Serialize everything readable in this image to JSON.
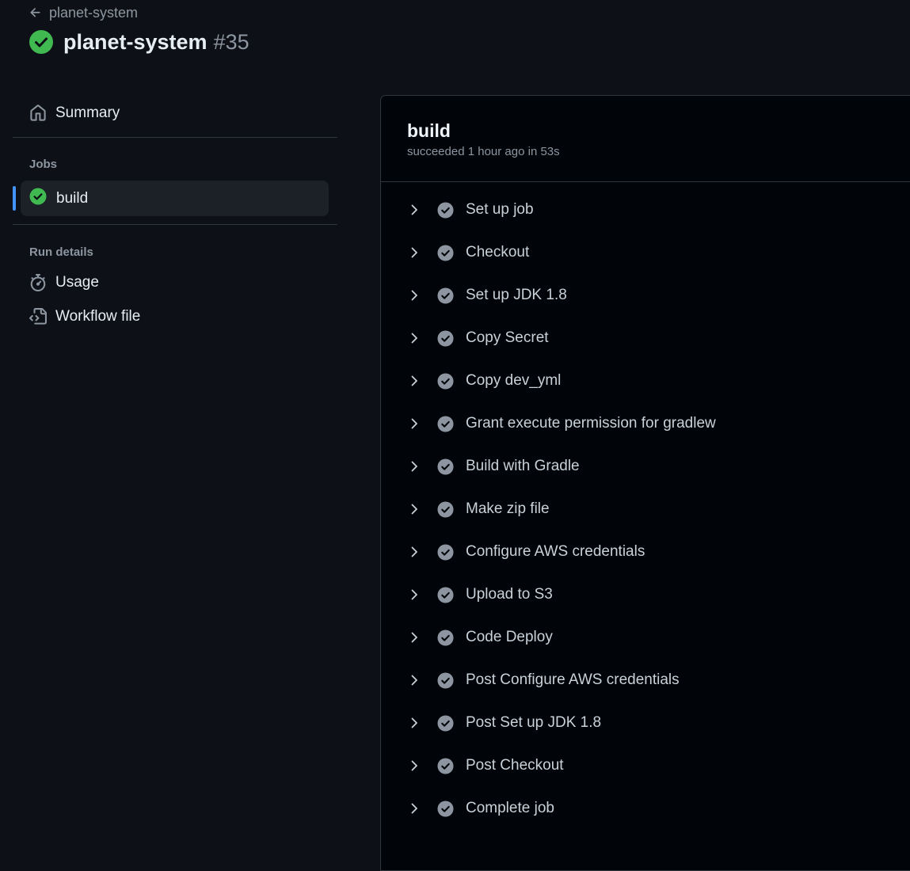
{
  "header": {
    "back_label": "planet-system",
    "title": "planet-system",
    "run_number": "#35",
    "status_color": "#3fb950"
  },
  "sidebar": {
    "summary_label": "Summary",
    "jobs_heading": "Jobs",
    "jobs": [
      {
        "label": "build",
        "status": "success",
        "active": true
      }
    ],
    "run_details_heading": "Run details",
    "run_details": [
      {
        "label": "Usage",
        "icon": "stopwatch-icon"
      },
      {
        "label": "Workflow file",
        "icon": "file-code-icon"
      }
    ]
  },
  "job_panel": {
    "title": "build",
    "subtitle": "succeeded 1 hour ago in 53s",
    "steps": [
      "Set up job",
      "Checkout",
      "Set up JDK 1.8",
      "Copy Secret",
      "Copy dev_yml",
      "Grant execute permission for gradlew",
      "Build with Gradle",
      "Make zip file",
      "Configure AWS credentials",
      "Upload to S3",
      "Code Deploy",
      "Post Configure AWS credentials",
      "Post Set up JDK 1.8",
      "Post Checkout",
      "Complete job"
    ]
  },
  "colors": {
    "background": "#0d1117",
    "panel": "#010409",
    "accent": "#4493f8",
    "success": "#3fb950",
    "step_check": "#8d96a0"
  }
}
